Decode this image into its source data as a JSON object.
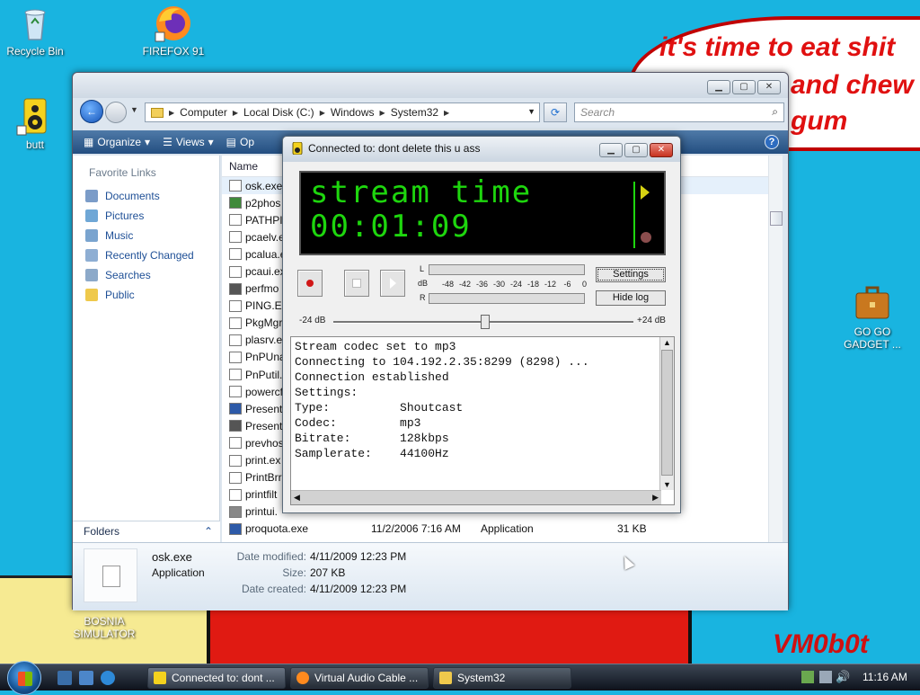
{
  "wallpaper": {
    "bubble_lines": [
      "it's time to eat shit",
      "and chew",
      "gum"
    ],
    "signature": "VM0b0t"
  },
  "desktop_icons": [
    {
      "label": "Recycle Bin",
      "icon": "recycle-bin-icon"
    },
    {
      "label": "FIREFOX 91",
      "icon": "firefox-icon"
    },
    {
      "label": "butt",
      "icon": "speaker-icon"
    },
    {
      "label": "GO GO GADGET ...",
      "icon": "briefcase-icon"
    },
    {
      "label": "BOSNIA SIMULATOR",
      "icon": "app-icon"
    }
  ],
  "explorer": {
    "breadcrumb": [
      "Computer",
      "Local Disk (C:)",
      "Windows",
      "System32"
    ],
    "search_placeholder": "Search",
    "toolbar": {
      "organize": "Organize",
      "views": "Views",
      "open": "Op"
    },
    "favorite_links_heading": "Favorite Links",
    "favorite_links": [
      "Documents",
      "Pictures",
      "Music",
      "Recently Changed",
      "Searches",
      "Public"
    ],
    "folders_label": "Folders",
    "column_name": "Name",
    "files": [
      "osk.exe",
      "p2phos",
      "PATHPI",
      "pcaelv.e",
      "pcalua.e",
      "pcaui.ex",
      "perfmo",
      "PING.EX",
      "PkgMgr",
      "plasrv.e",
      "PnPUna",
      "PnPutil.",
      "powercf",
      "Present",
      "Present",
      "prevhos",
      "print.ex",
      "PrintBrr",
      "printfilt",
      "printui."
    ],
    "last_file": {
      "name": "proquota.exe",
      "date": "11/2/2006 7:16 AM",
      "type": "Application",
      "size": "31 KB"
    },
    "details": {
      "name": "osk.exe",
      "type": "Application",
      "modified_label": "Date modified:",
      "modified": "4/11/2009 12:23 PM",
      "size_label": "Size:",
      "size": "207 KB",
      "created_label": "Date created:",
      "created": "4/11/2009 12:23 PM"
    }
  },
  "butt": {
    "title": "Connected to: dont delete this u ass",
    "lcd_line1": "stream time",
    "lcd_line2": "00:01:09",
    "vu_labels": {
      "left": "L",
      "db": "dB",
      "right": "R"
    },
    "vu_scale": [
      "-48",
      "-42",
      "-36",
      "-30",
      "-24",
      "-18",
      "-12",
      "-6",
      "0"
    ],
    "settings_button": "Settings",
    "hide_log_button": "Hide log",
    "gain_min": "-24 dB",
    "gain_max": "+24 dB",
    "log_lines": [
      "Stream codec set to mp3",
      "Connecting to 104.192.2.35:8299 (8298) ...",
      "Connection established",
      "Settings:",
      "Type:          Shoutcast",
      "Codec:         mp3",
      "Bitrate:       128kbps",
      "Samplerate:    44100Hz"
    ]
  },
  "taskbar": {
    "buttons": [
      "Connected to: dont ...",
      "Virtual Audio Cable ...",
      "System32"
    ],
    "clock": "11:16 AM"
  }
}
